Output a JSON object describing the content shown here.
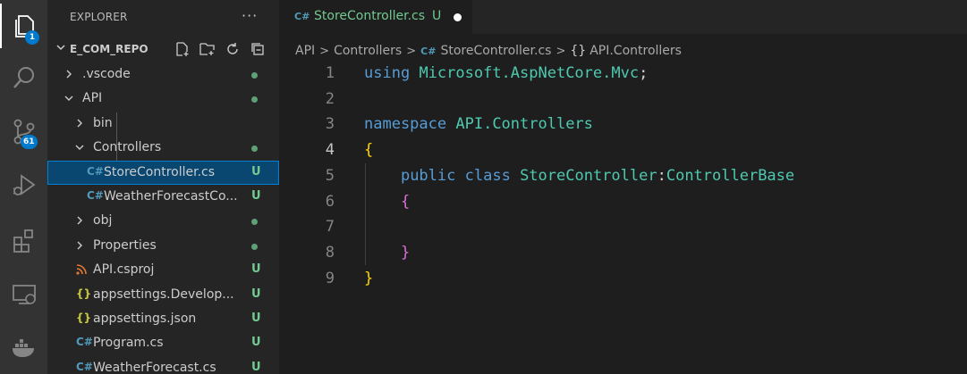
{
  "activity_bar": {
    "items": [
      {
        "icon": "files-icon",
        "badge": "1"
      },
      {
        "icon": "search-icon"
      },
      {
        "icon": "source-control-icon",
        "badge": "61"
      },
      {
        "icon": "run-debug-icon"
      },
      {
        "icon": "extensions-icon"
      },
      {
        "icon": "remote-explorer-icon"
      },
      {
        "icon": "docker-icon"
      }
    ]
  },
  "sidebar": {
    "title": "EXPLORER",
    "more": "···",
    "section": "E_COM_REPO",
    "tree": [
      {
        "label": ".vscode",
        "kind": "folder",
        "expanded": false,
        "status": "dot"
      },
      {
        "label": "API",
        "kind": "folder",
        "expanded": true,
        "status": "dot"
      },
      {
        "label": "bin",
        "kind": "folder",
        "expanded": false,
        "status": ""
      },
      {
        "label": "Controllers",
        "kind": "folder",
        "expanded": true,
        "status": "dot"
      },
      {
        "label": "StoreController.cs",
        "kind": "csharp",
        "icon_text": "C#",
        "status": "U",
        "selected": true
      },
      {
        "label": "WeatherForecastCo...",
        "kind": "csharp",
        "icon_text": "C#",
        "status": "U"
      },
      {
        "label": "obj",
        "kind": "folder",
        "expanded": false,
        "status": "dot"
      },
      {
        "label": "Properties",
        "kind": "folder",
        "expanded": false,
        "status": "dot"
      },
      {
        "label": "API.csproj",
        "kind": "rss",
        "status": "U"
      },
      {
        "label": "appsettings.Develop...",
        "kind": "json",
        "icon_text": "{}",
        "status": "U"
      },
      {
        "label": "appsettings.json",
        "kind": "json",
        "icon_text": "{}",
        "status": "U"
      },
      {
        "label": "Program.cs",
        "kind": "csharp",
        "icon_text": "C#",
        "status": "U"
      },
      {
        "label": "WeatherForecast.cs",
        "kind": "csharp",
        "icon_text": "C#",
        "status": "U"
      }
    ]
  },
  "editor": {
    "tab": {
      "icon_text": "C#",
      "label": "StoreController.cs",
      "status": "U"
    },
    "breadcrumbs": {
      "parts": [
        "API",
        "Controllers",
        "StoreController.cs",
        "API.Controllers"
      ],
      "cs_icon": "C#",
      "namespace_icon": "{}"
    },
    "active_line": 4,
    "lines": [
      {
        "n": "1",
        "tokens": [
          [
            "kw",
            "using"
          ],
          [
            "plain",
            " "
          ],
          [
            "ns",
            "Microsoft.AspNetCore.Mvc"
          ],
          [
            "plain",
            ";"
          ]
        ]
      },
      {
        "n": "2",
        "tokens": []
      },
      {
        "n": "3",
        "tokens": [
          [
            "kw",
            "namespace"
          ],
          [
            "plain",
            " "
          ],
          [
            "ns",
            "API.Controllers"
          ]
        ]
      },
      {
        "n": "4",
        "tokens": [
          [
            "br1",
            "{"
          ]
        ]
      },
      {
        "n": "5",
        "tokens": [
          [
            "plain",
            "    "
          ],
          [
            "kw",
            "public"
          ],
          [
            "plain",
            " "
          ],
          [
            "kw",
            "class"
          ],
          [
            "plain",
            " "
          ],
          [
            "ns",
            "StoreController"
          ],
          [
            "plain",
            ":"
          ],
          [
            "ns",
            "ControllerBase"
          ]
        ]
      },
      {
        "n": "6",
        "tokens": [
          [
            "plain",
            "    "
          ],
          [
            "br2",
            "{"
          ]
        ]
      },
      {
        "n": "7",
        "tokens": []
      },
      {
        "n": "8",
        "tokens": [
          [
            "plain",
            "    "
          ],
          [
            "br2",
            "}"
          ]
        ]
      },
      {
        "n": "9",
        "tokens": [
          [
            "br1",
            "}"
          ]
        ]
      }
    ]
  },
  "colors": {
    "accent": "#007acc",
    "git_untracked": "#73c991",
    "keyword": "#569cd6",
    "type": "#4ec9b0",
    "bracket_1": "#ffd700",
    "bracket_2": "#da70d6"
  }
}
